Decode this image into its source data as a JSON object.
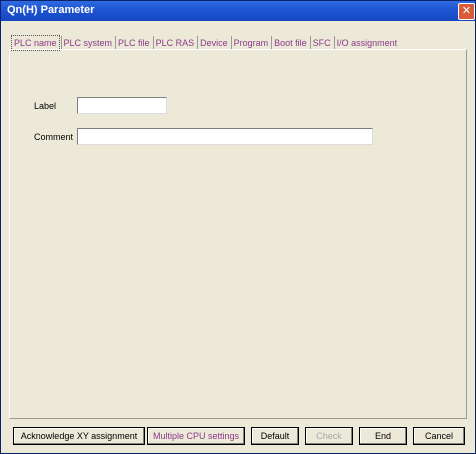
{
  "window": {
    "title": "Qn(H) Parameter",
    "close_glyph": "✕"
  },
  "tabs": [
    "PLC name",
    "PLC system",
    "PLC file",
    "PLC RAS",
    "Device",
    "Program",
    "Boot file",
    "SFC",
    "I/O assignment"
  ],
  "active_tab": "PLC name",
  "form": {
    "label_caption": "Label",
    "label_value": "",
    "comment_caption": "Comment",
    "comment_value": ""
  },
  "buttons": {
    "acknowledge": "Acknowledge XY assignment",
    "multiple_cpu": "Multiple CPU settings",
    "default": "Default",
    "check": "Check",
    "end": "End",
    "cancel": "Cancel"
  }
}
